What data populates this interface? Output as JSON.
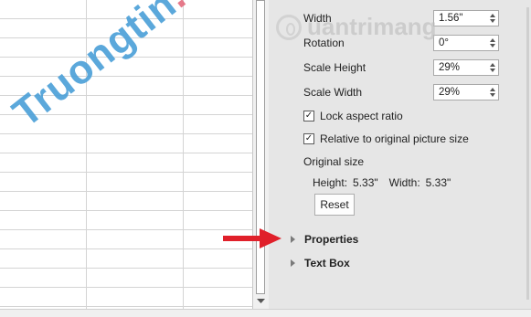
{
  "watermarks": {
    "left_part1": "Truongtin",
    "left_part2": ".top",
    "right": "uantrimang"
  },
  "format_pane": {
    "fields": [
      {
        "label": "Width",
        "value": "1.56\""
      },
      {
        "label": "Rotation",
        "value": "0°"
      },
      {
        "label": "Scale Height",
        "value": "29%"
      },
      {
        "label": "Scale Width",
        "value": "29%"
      }
    ],
    "checkboxes": [
      {
        "label": "Lock aspect ratio",
        "checked": true
      },
      {
        "label": "Relative to original picture size",
        "checked": true
      }
    ],
    "original_size": {
      "title": "Original size",
      "height_label": "Height:",
      "height_value": "5.33\"",
      "width_label": "Width:",
      "width_value": "5.33\""
    },
    "reset_label": "Reset",
    "sections": [
      {
        "label": "Properties"
      },
      {
        "label": "Text Box"
      }
    ],
    "check_mark": "✓"
  },
  "colors": {
    "arrow": "#e0202a",
    "pane_bg": "#e6e6e6"
  },
  "icons": {
    "scroll_down": "scroll-down-arrow-icon",
    "pointer": "red-arrow-icon",
    "expand": "caret-right-icon"
  }
}
